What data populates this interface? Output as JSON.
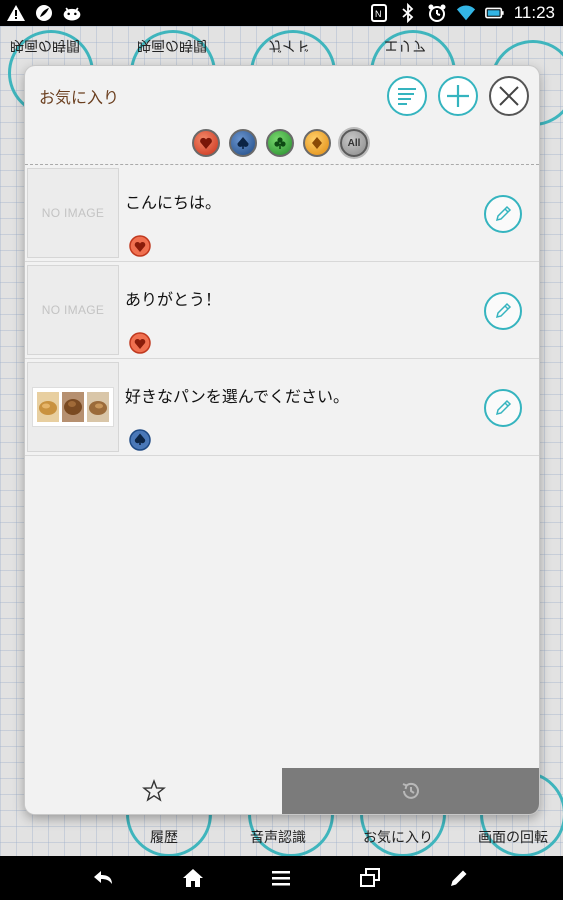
{
  "status_bar": {
    "time": "11:23",
    "left_icons": [
      "warning-icon",
      "leaf-icon",
      "android-icon"
    ],
    "right_icons": [
      "nfc-icon",
      "bluetooth-icon",
      "alarm-icon",
      "wifi-icon",
      "battery-icon"
    ]
  },
  "background_app": {
    "top_labels": [
      "映画の時間",
      "映画の時間",
      "ガイド",
      "エリア"
    ],
    "bottom_labels": [
      "履歴",
      "音声認識",
      "お気に入り",
      "画面の回転"
    ]
  },
  "dialog": {
    "title": "お気に入り",
    "header_buttons": [
      "sort-icon",
      "add-icon",
      "close-icon"
    ],
    "filters": [
      {
        "icon": "heart-icon",
        "color": "#e04a2a"
      },
      {
        "icon": "spade-icon",
        "color": "#2a5e9e"
      },
      {
        "icon": "club-icon",
        "color": "#2fa43a"
      },
      {
        "icon": "diamond-icon",
        "color": "#f0a020"
      },
      {
        "label": "All",
        "color": "#9a9a9a"
      }
    ],
    "items": [
      {
        "image_label": "NO IMAGE",
        "text": "こんにちは。",
        "suit": "heart-icon"
      },
      {
        "image_label": "NO IMAGE",
        "text": "ありがとう！",
        "suit": "heart-icon"
      },
      {
        "image": "bread-photos",
        "text": "好きなパンを選んでください。",
        "suit": "spade-icon"
      }
    ],
    "tabs": [
      {
        "icon": "star-icon",
        "selected": true
      },
      {
        "icon": "history-icon",
        "selected": false
      }
    ]
  },
  "navigation_bar": [
    "back-icon",
    "home-icon",
    "menu-icon",
    "recent-apps-icon",
    "pen-icon"
  ],
  "colors": {
    "accent": "#35b4bf",
    "title_text": "#6b3f1f",
    "heart": "#e04a2a",
    "spade": "#2a5e9e",
    "club": "#2fa43a",
    "diamond": "#f0a020"
  }
}
